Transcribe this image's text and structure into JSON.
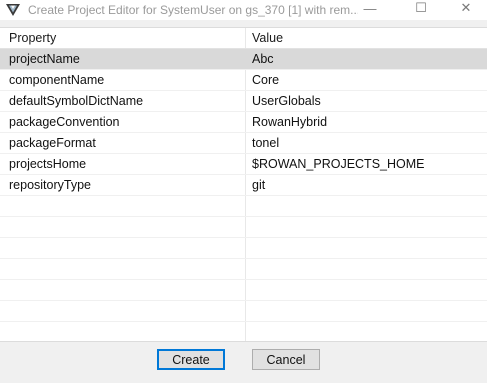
{
  "window": {
    "title": "Create Project Editor for SystemUser on gs_370 [1] with rem...",
    "app_icon": "gemstone-v-icon",
    "minimize_glyph": "—",
    "maximize_glyph": "☐",
    "close_glyph": "✕"
  },
  "table": {
    "headers": {
      "property": "Property",
      "value": "Value"
    },
    "rows": [
      {
        "property": "projectName",
        "value": "Abc",
        "selected": true
      },
      {
        "property": "componentName",
        "value": "Core"
      },
      {
        "property": "defaultSymbolDictName",
        "value": "UserGlobals"
      },
      {
        "property": "packageConvention",
        "value": "RowanHybrid"
      },
      {
        "property": "packageFormat",
        "value": "tonel"
      },
      {
        "property": "projectsHome",
        "value": "$ROWAN_PROJECTS_HOME"
      },
      {
        "property": "repositoryType",
        "value": "git"
      }
    ]
  },
  "buttons": {
    "create": "Create",
    "cancel": "Cancel"
  }
}
